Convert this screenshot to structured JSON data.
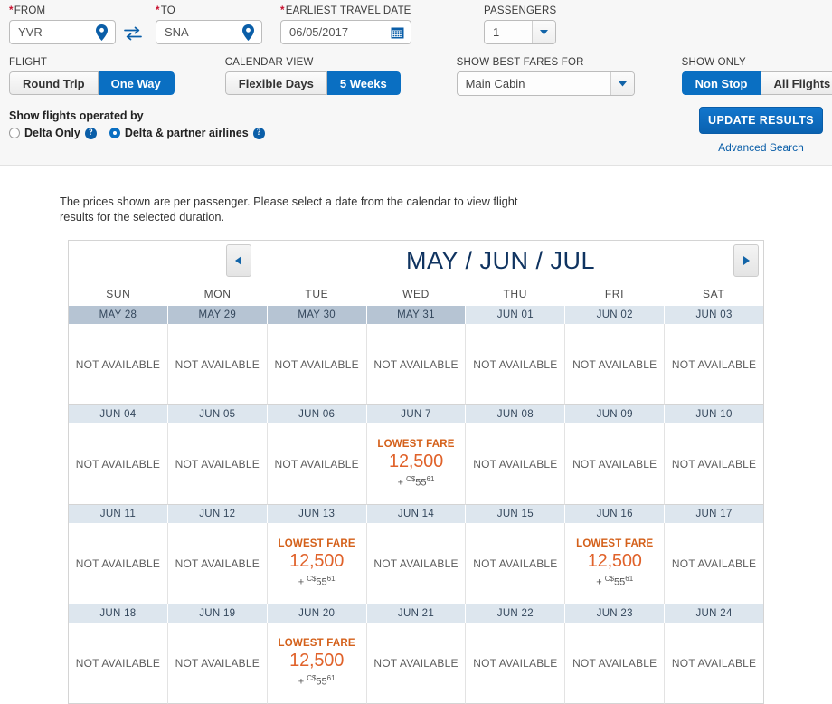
{
  "search": {
    "from": {
      "label": "FROM",
      "required": true,
      "value": "YVR",
      "icon": "location-pin-icon"
    },
    "swap": {
      "icon": "swap-arrows-icon"
    },
    "to": {
      "label": "TO",
      "required": true,
      "value": "SNA",
      "icon": "location-pin-icon"
    },
    "date": {
      "label": "EARLIEST TRAVEL DATE",
      "required": true,
      "value": "06/05/2017",
      "icon": "calendar-icon"
    },
    "passengers": {
      "label": "PASSENGERS",
      "value": "1"
    },
    "flight": {
      "label": "FLIGHT",
      "options": [
        "Round Trip",
        "One Way"
      ],
      "selected": "One Way"
    },
    "calendar_view": {
      "label": "CALENDAR VIEW",
      "options": [
        "Flexible Days",
        "5 Weeks"
      ],
      "selected": "5 Weeks"
    },
    "best_fares": {
      "label": "SHOW BEST FARES FOR",
      "value": "Main Cabin"
    },
    "show_only": {
      "label": "SHOW ONLY",
      "options": [
        "Non Stop",
        "All Flights"
      ],
      "selected": "Non Stop"
    },
    "operated_by": {
      "label": "Show flights operated by",
      "options": [
        {
          "label": "Delta Only",
          "selected": false,
          "help": "?"
        },
        {
          "label": "Delta & partner airlines",
          "selected": true,
          "help": "?"
        }
      ]
    },
    "update_label": "UPDATE RESULTS",
    "advanced_search": "Advanced Search"
  },
  "notice": "The prices shown are per passenger. Please select a date from the calendar to view flight results for the selected duration.",
  "calendar": {
    "title": "MAY / JUN / JUL",
    "prev_icon": "triangle-left-icon",
    "next_icon": "triangle-right-icon",
    "day_headers": [
      "SUN",
      "MON",
      "TUE",
      "WED",
      "THU",
      "FRI",
      "SAT"
    ],
    "not_available_text": "NOT AVAILABLE",
    "lowest_fare_label": "LOWEST FARE",
    "accent_fare_color": "#e0622a",
    "accent_blue": "#0a6fc2",
    "weeks": [
      {
        "days": [
          {
            "date": "MAY 28",
            "month": "prev",
            "available": false
          },
          {
            "date": "MAY 29",
            "month": "prev",
            "available": false
          },
          {
            "date": "MAY 30",
            "month": "prev",
            "available": false
          },
          {
            "date": "MAY 31",
            "month": "prev",
            "available": false
          },
          {
            "date": "JUN 01",
            "month": "cur",
            "available": false
          },
          {
            "date": "JUN 02",
            "month": "cur",
            "available": false
          },
          {
            "date": "JUN 03",
            "month": "cur",
            "available": false
          }
        ]
      },
      {
        "days": [
          {
            "date": "JUN 04",
            "month": "cur",
            "available": false
          },
          {
            "date": "JUN 05",
            "month": "cur",
            "available": false
          },
          {
            "date": "JUN 06",
            "month": "cur",
            "available": false
          },
          {
            "date": "JUN 7",
            "month": "cur",
            "available": true,
            "fare": "12,500",
            "tax_prefix": "+",
            "tax_currency": "C$",
            "tax_amount": "55",
            "tax_sup": "61"
          },
          {
            "date": "JUN 08",
            "month": "cur",
            "available": false
          },
          {
            "date": "JUN 09",
            "month": "cur",
            "available": false
          },
          {
            "date": "JUN 10",
            "month": "cur",
            "available": false
          }
        ]
      },
      {
        "days": [
          {
            "date": "JUN 11",
            "month": "cur",
            "available": false
          },
          {
            "date": "JUN 12",
            "month": "cur",
            "available": false
          },
          {
            "date": "JUN 13",
            "month": "cur",
            "available": true,
            "fare": "12,500",
            "tax_prefix": "+",
            "tax_currency": "C$",
            "tax_amount": "55",
            "tax_sup": "61"
          },
          {
            "date": "JUN 14",
            "month": "cur",
            "available": false
          },
          {
            "date": "JUN 15",
            "month": "cur",
            "available": false
          },
          {
            "date": "JUN 16",
            "month": "cur",
            "available": true,
            "fare": "12,500",
            "tax_prefix": "+",
            "tax_currency": "C$",
            "tax_amount": "55",
            "tax_sup": "61"
          },
          {
            "date": "JUN 17",
            "month": "cur",
            "available": false
          }
        ]
      },
      {
        "days": [
          {
            "date": "JUN 18",
            "month": "cur",
            "available": false
          },
          {
            "date": "JUN 19",
            "month": "cur",
            "available": false
          },
          {
            "date": "JUN 20",
            "month": "cur",
            "available": true,
            "fare": "12,500",
            "tax_prefix": "+",
            "tax_currency": "C$",
            "tax_amount": "55",
            "tax_sup": "61"
          },
          {
            "date": "JUN 21",
            "month": "cur",
            "available": false
          },
          {
            "date": "JUN 22",
            "month": "cur",
            "available": false
          },
          {
            "date": "JUN 23",
            "month": "cur",
            "available": false
          },
          {
            "date": "JUN 24",
            "month": "cur",
            "available": false
          }
        ]
      }
    ]
  }
}
